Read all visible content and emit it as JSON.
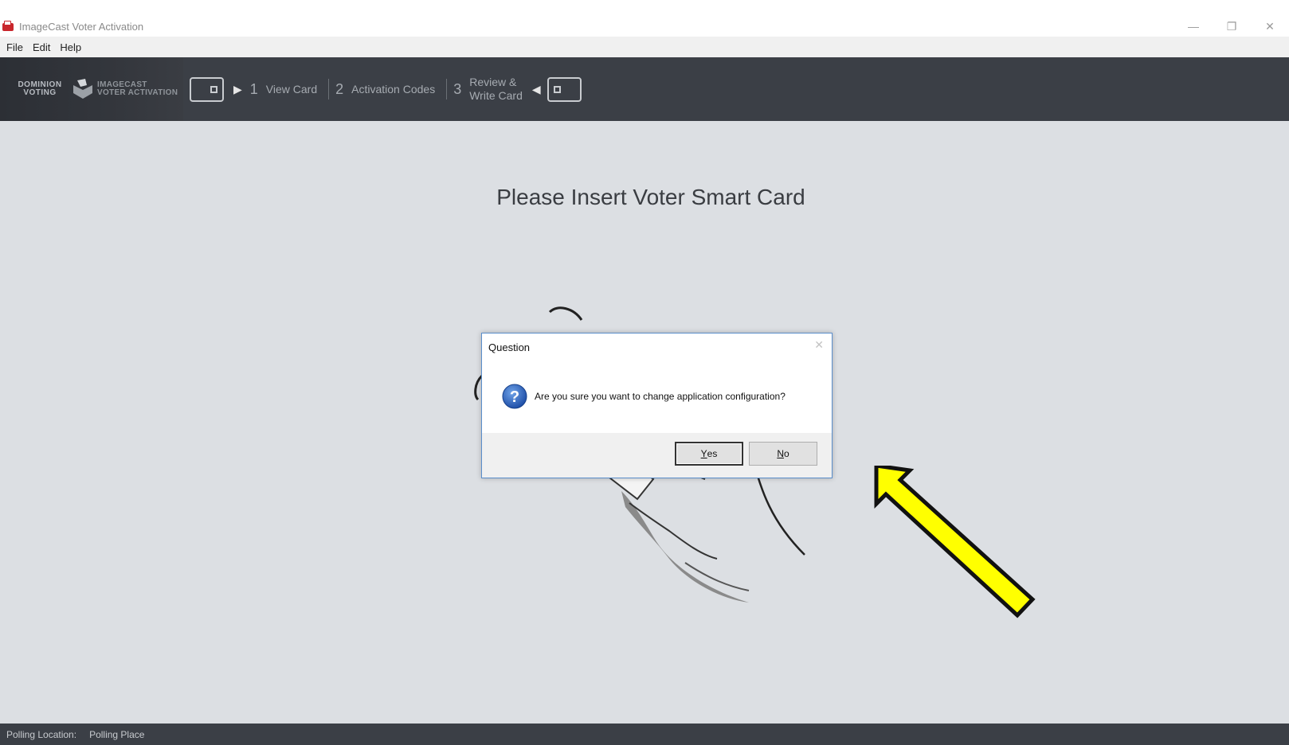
{
  "window": {
    "title": "ImageCast Voter Activation",
    "controls": {
      "minimize": "—",
      "restore": "❐",
      "close": "✕"
    }
  },
  "menu": {
    "items": [
      "File",
      "Edit",
      "Help"
    ]
  },
  "toolbar": {
    "logo": {
      "left_line1": "DOMINION",
      "left_line2": "VOTING",
      "right_line1": "IMAGECAST",
      "right_line2": "VOTER ACTIVATION"
    },
    "steps": [
      {
        "number": "1",
        "label": "View Card"
      },
      {
        "number": "2",
        "label": "Activation Codes"
      },
      {
        "number": "3",
        "label_line1": "Review &",
        "label_line2": "Write Card"
      }
    ]
  },
  "main": {
    "prompt": "Please Insert Voter Smart Card"
  },
  "dialog": {
    "title": "Question",
    "message": "Are you sure you want to change application configuration?",
    "yes_label": {
      "accel": "Y",
      "rest": "es"
    },
    "no_label": {
      "accel": "N",
      "rest": "o"
    },
    "close": "✕"
  },
  "status": {
    "label": "Polling Location:",
    "value": "Polling Place"
  },
  "colors": {
    "toolbar": "#3b3f46",
    "main_bg": "#dcdfe3",
    "arrow": "#ffff00",
    "dialog_border": "#5a8ecb",
    "question_icon": "#1f5fbf"
  },
  "icons": [
    "app-ballot-icon",
    "question-icon",
    "card-slot-icon",
    "hand-card-illustration",
    "yellow-arrow"
  ]
}
